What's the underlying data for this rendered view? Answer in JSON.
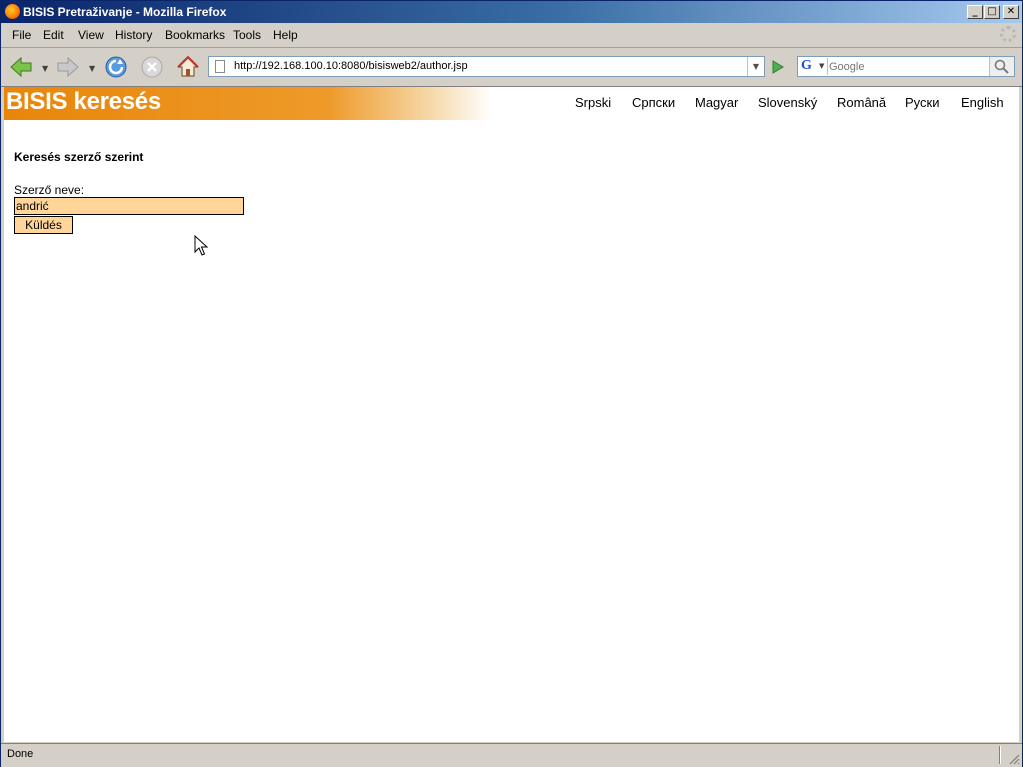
{
  "window": {
    "title": "BISIS Pretraživanje - Mozilla Firefox",
    "icon": "firefox-icon"
  },
  "menu": {
    "items": [
      "File",
      "Edit",
      "View",
      "History",
      "Bookmarks",
      "Tools",
      "Help"
    ]
  },
  "toolbar": {
    "url": "http://192.168.100.10:8080/bisisweb2/author.jsp",
    "search_placeholder": "Google",
    "search_engine_icon": "google-icon"
  },
  "page": {
    "brand": "BISIS keresés",
    "languages": [
      "Srpski",
      "Српски",
      "Magyar",
      "Slovenský",
      "Română",
      "Руски",
      "English"
    ],
    "heading": "Keresés szerző szerint",
    "author_label": "Szerző neve:",
    "author_value": "andrić",
    "submit_label": "Küldés"
  },
  "status": {
    "text": "Done"
  },
  "colors": {
    "banner_orange": "#e8860a",
    "input_fill": "#ffd59a",
    "titlebar_blue": "#0a246a"
  }
}
